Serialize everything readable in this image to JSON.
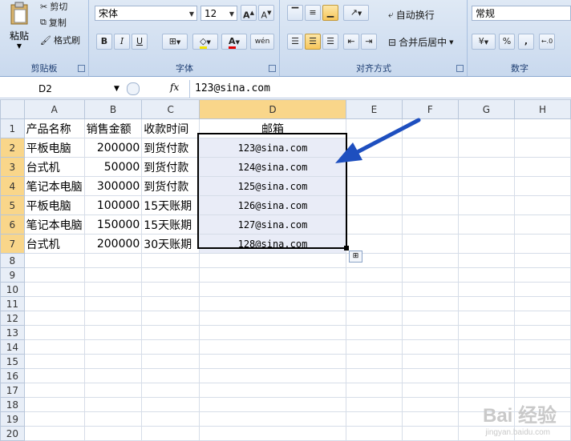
{
  "ribbon": {
    "clipboard": {
      "label": "剪贴板",
      "paste": "粘贴",
      "cut": "剪切",
      "copy": "复制",
      "format_painter": "格式刷"
    },
    "font": {
      "label": "字体",
      "family": "宋体",
      "size": "12",
      "bold": "B",
      "italic": "I",
      "underline": "U"
    },
    "alignment": {
      "label": "对齐方式",
      "wrap_text": "自动换行",
      "merge_center": "合并后居中"
    },
    "number": {
      "label": "数字",
      "format": "常规",
      "percent": "%",
      "comma": ","
    }
  },
  "formula_bar": {
    "name_box": "D2",
    "fx": "fx",
    "content": "123@sina.com"
  },
  "columns": [
    "A",
    "B",
    "C",
    "D",
    "E",
    "F",
    "G",
    "H"
  ],
  "header_row": {
    "a": "产品名称",
    "b": "销售金额",
    "c": "收款时间",
    "d": "邮箱"
  },
  "rows": [
    {
      "num": "2",
      "a": "平板电脑",
      "b": "200000",
      "c": "到货付款",
      "d": "123@sina.com"
    },
    {
      "num": "3",
      "a": "台式机",
      "b": "50000",
      "c": "到货付款",
      "d": "124@sina.com"
    },
    {
      "num": "4",
      "a": "笔记本电脑",
      "b": "300000",
      "c": "到货付款",
      "d": "125@sina.com"
    },
    {
      "num": "5",
      "a": "平板电脑",
      "b": "100000",
      "c": "15天账期",
      "d": "126@sina.com"
    },
    {
      "num": "6",
      "a": "笔记本电脑",
      "b": "150000",
      "c": "15天账期",
      "d": "127@sina.com"
    },
    {
      "num": "7",
      "a": "台式机",
      "b": "200000",
      "c": "30天账期",
      "d": "128@sina.com"
    }
  ],
  "empty_rows": [
    "8",
    "9",
    "10",
    "11",
    "12",
    "13",
    "14",
    "15",
    "16",
    "17",
    "18",
    "19",
    "20"
  ],
  "watermark": {
    "main": "Bai  经验",
    "sub": "jingyan.baidu.com"
  },
  "colors": {
    "arrow": "#1e4fbf",
    "selection_fill": "#e9ecf7",
    "header_sel": "#f9d68a"
  }
}
